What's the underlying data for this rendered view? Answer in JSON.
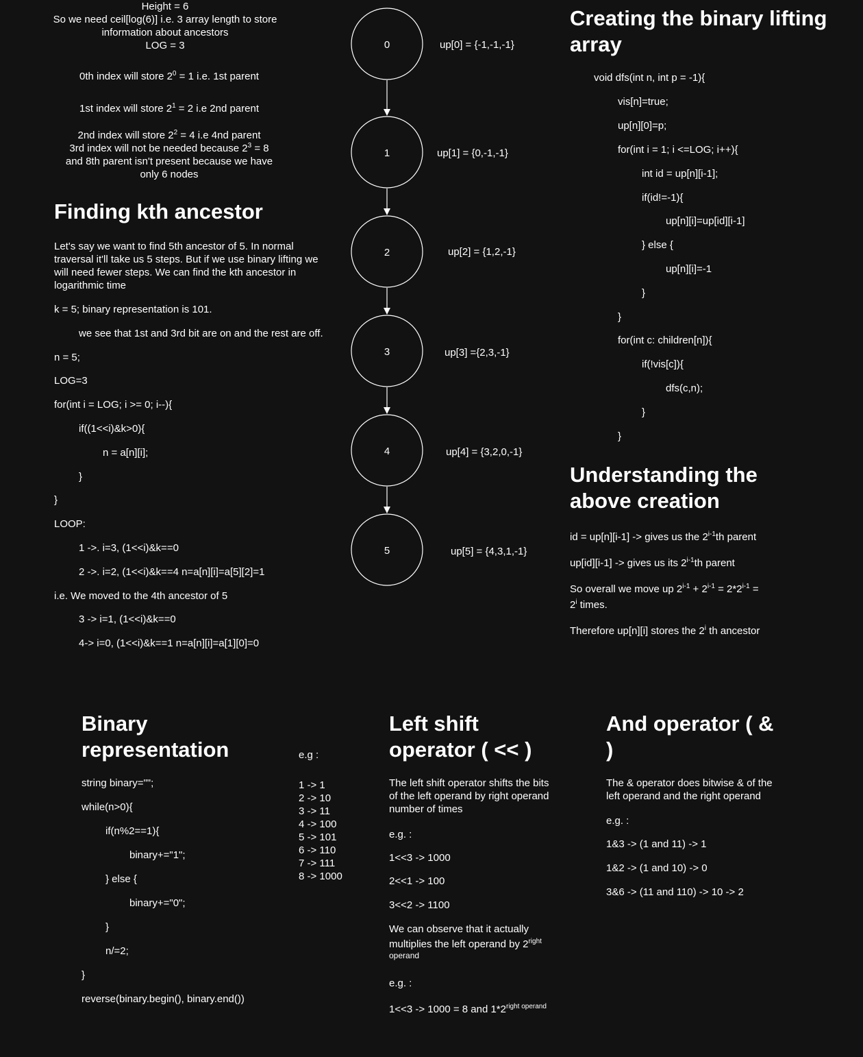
{
  "intro": {
    "height_line": "Height = 6",
    "ceil_line1": "So we need ceil[log(6)] i.e. 3 array length to store",
    "ceil_line2": "information about ancestors",
    "log_line": "LOG = 3",
    "idx0_pre": "0th index will store 2",
    "idx0_sup": "0",
    "idx0_post": " = 1 i.e. 1st parent",
    "idx1_pre": "1st index will store 2",
    "idx1_sup": "1",
    "idx1_post": " = 2 i.e 2nd parent",
    "idx2_pre": "2nd index will store 2",
    "idx2_sup": "2",
    "idx2_post": " = 4 i.e 4nd parent",
    "idx3_pre": "3rd index will not be needed because 2",
    "idx3_sup": "3",
    "idx3_post": " = 8",
    "idx3_line2": "and 8th parent isn't present because we have",
    "idx3_line3": "only 6 nodes"
  },
  "kth": {
    "title": "Finding kth ancestor",
    "para": [
      "Let's say we want to find 5th ancestor of 5. In normal",
      "traversal it'll take us 5 steps. But if we use binary lifting we",
      "will need fewer steps. We can find the kth ancestor in",
      "logarithmic time"
    ],
    "lines": [
      "k = 5;   binary representation is 101.",
      "we see that 1st and 3rd bit are on and the rest are off.",
      "n = 5;",
      "LOG=3",
      "for(int i = LOG; i >= 0; i--){",
      "if((1<<i)&k>0){",
      "n = a[n][i];",
      "}",
      "}",
      "LOOP:",
      "1 ->. i=3, (1<<i)&k==0",
      "2 ->. i=2, (1<<i)&k==4 n=a[n][i]=a[5][2]=1",
      "i.e. We moved to the 4th ancestor of 5",
      "3 -> i=1, (1<<i)&k==0",
      "4-> i=0, (1<<i)&k==1 n=a[n][i]=a[1][0]=0"
    ]
  },
  "tree": {
    "nodes": [
      {
        "label": "0",
        "up": "up[0] = {-1,-1,-1}"
      },
      {
        "label": "1",
        "up": "up[1] = {0,-1,-1}"
      },
      {
        "label": "2",
        "up": "up[2] = {1,2,-1}"
      },
      {
        "label": "3",
        "up": "up[3] ={2,3,-1}"
      },
      {
        "label": "4",
        "up": "up[4] = {3,2,0,-1}"
      },
      {
        "label": "5",
        "up": "up[5] = {4,3,1,-1}"
      }
    ]
  },
  "creating": {
    "title_line1": "Creating the binary lifting",
    "title_line2": "array",
    "code": [
      "void dfs(int n, int p = -1){",
      "vis[n]=true;",
      "up[n][0]=p;",
      "for(int i = 1; i <=LOG; i++){",
      "int id = up[n][i-1];",
      "if(id!=-1){",
      "up[n][i]=up[id][i-1]",
      "} else {",
      "up[n][i]=-1",
      "}",
      "}",
      "for(int c: children[n]){",
      "if(!vis[c]){",
      "dfs(c,n);",
      "}",
      "}"
    ]
  },
  "understanding": {
    "title_line1": "Understanding the",
    "title_line2": "above creation",
    "l1_pre": "id = up[n][i-1] -> gives us the 2",
    "l1_sup": "i-1",
    "l1_post": "th parent",
    "l2_pre": "up[id][i-1] -> gives us its 2",
    "l2_sup": "i-1",
    "l2_post": "th parent",
    "l3_a": "So overall we move up 2",
    "l3_sup1": "i-1",
    "l3_b": " + 2",
    "l3_sup2": "i-1",
    "l3_c": " = 2*2",
    "l3_sup3": "i-1",
    "l3_d": " =",
    "l4_pre": "2",
    "l4_sup": "i",
    "l4_post": " times.",
    "l5_pre": "Therefore up[n][i] stores the 2",
    "l5_sup": "i",
    "l5_post": " th ancestor"
  },
  "binary": {
    "title_line1": "Binary",
    "title_line2": "representation",
    "code": [
      "string binary=\"\";",
      "while(n>0){",
      "if(n%2==1){",
      "binary+=\"1\";",
      "} else {",
      "binary+=\"0\";",
      "}",
      "n/=2;",
      "}",
      "reverse(binary.begin(), binary.end())"
    ],
    "eg_label": "e.g :",
    "examples": [
      "1 -> 1",
      "2 -> 10",
      "3 -> 11",
      "4 -> 100",
      "5 -> 101",
      "6 -> 110",
      "7 -> 111",
      "8 -> 1000"
    ]
  },
  "leftshift": {
    "title_line1": "Left shift",
    "title_line2": "operator ( << )",
    "desc": [
      "The left shift operator shifts the bits",
      "of the left operand by right operand",
      "number of times"
    ],
    "eg1": "e.g. :",
    "ex": [
      "1<<3  -> 1000",
      "2<<1 -> 100",
      "3<<2 -> 1100"
    ],
    "obs_line1": "We can observe that it actually",
    "obs_pre": "multiplies the left operand by 2",
    "obs_sup": "right",
    "obs_line3": "operand",
    "eg2": "e.g. :",
    "final_pre": "1<<3 -> 1000 = 8 and 1*2",
    "final_sup": "right operand"
  },
  "andop": {
    "title_line1": "And operator ( &",
    "title_line2": ")",
    "desc": [
      "The & operator does bitwise & of the",
      "left operand and the right operand"
    ],
    "eg": "e.g. :",
    "ex": [
      "1&3  ->  (1 and 11) -> 1",
      "1&2 -> (1 and 10) -> 0",
      "3&6 -> (11 and 110) -> 10 -> 2"
    ]
  }
}
